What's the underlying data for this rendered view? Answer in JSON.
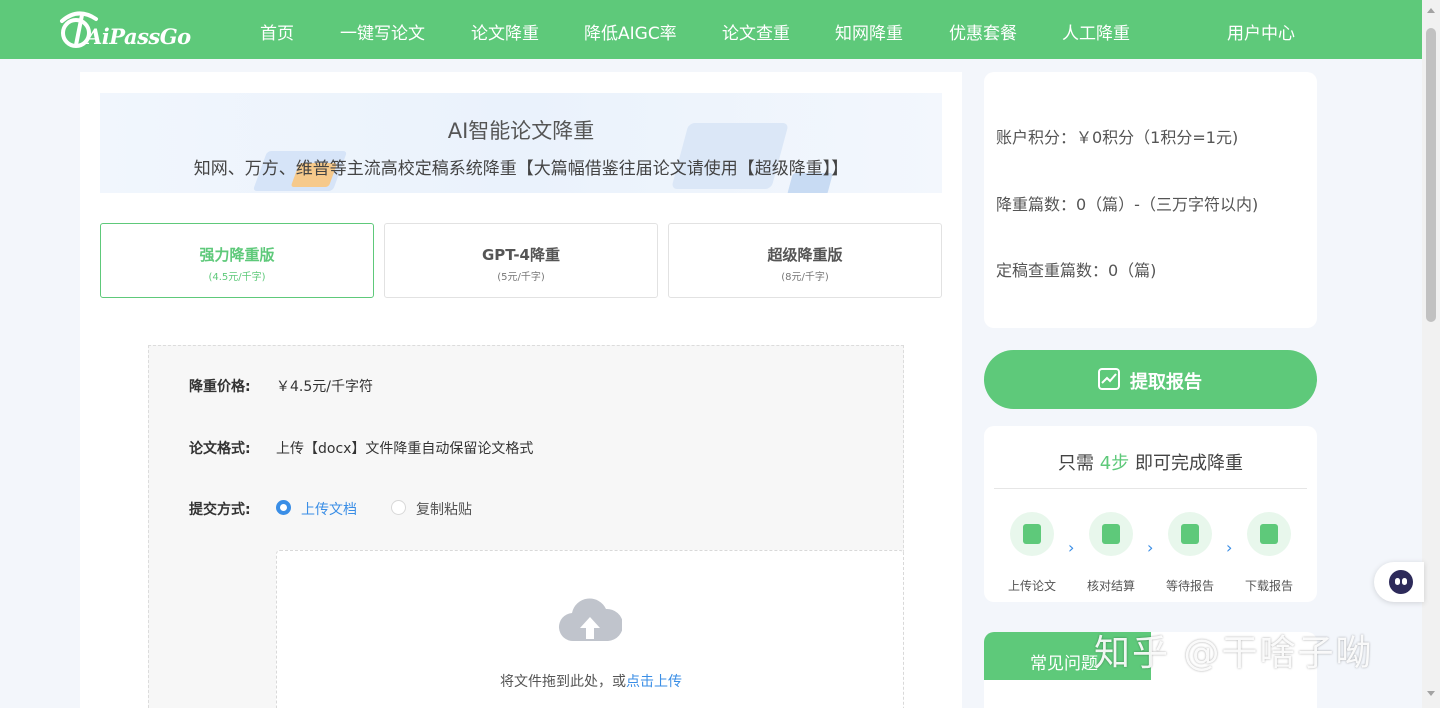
{
  "brand": {
    "name": "AiPassGo"
  },
  "nav": {
    "items": [
      "首页",
      "一键写论文",
      "论文降重",
      "降低AIGC率",
      "论文查重",
      "知网降重",
      "优惠套餐",
      "人工降重"
    ],
    "user_center": "用户中心"
  },
  "banner": {
    "title": "AI智能论文降重",
    "subtitle": "知网、万方、维普等主流高校定稿系统降重【大篇幅借鉴往届论文请使用【超级降重】】"
  },
  "plans": [
    {
      "name": "强力降重版",
      "price": "(4.5元/千字)",
      "active": true
    },
    {
      "name": "GPT-4降重",
      "price": "(5元/千字)",
      "active": false
    },
    {
      "name": "超级降重版",
      "price": "(8元/千字)",
      "active": false
    }
  ],
  "form": {
    "price_label": "降重价格:",
    "price_value": "￥4.5元/千字符",
    "format_label": "论文格式:",
    "format_value": "上传【docx】文件降重自动保留论文格式",
    "submit_label": "提交方式:",
    "submit_options": [
      "上传文档",
      "复制粘贴"
    ],
    "submit_selected": "上传文档",
    "upload_hint": "将文件拖到此处，或",
    "upload_link": "点击上传"
  },
  "account": {
    "points": "账户积分：￥0积分（1积分=1元)",
    "rewrite_count": "降重篇数：0（篇）-（三万字符以内)",
    "check_count": "定稿查重篇数：0（篇)"
  },
  "report_button": "提取报告",
  "steps": {
    "title_prefix": "只需",
    "title_highlight": "4步",
    "title_suffix": "即可完成降重",
    "items": [
      "上传论文",
      "核对结算",
      "等待报告",
      "下载报告"
    ],
    "arrow": "›"
  },
  "faq": {
    "label": "常见问题"
  },
  "watermark": "知乎 @干啥子呦",
  "colors": {
    "primary": "#5ec97a",
    "link": "#3a8ee6"
  }
}
